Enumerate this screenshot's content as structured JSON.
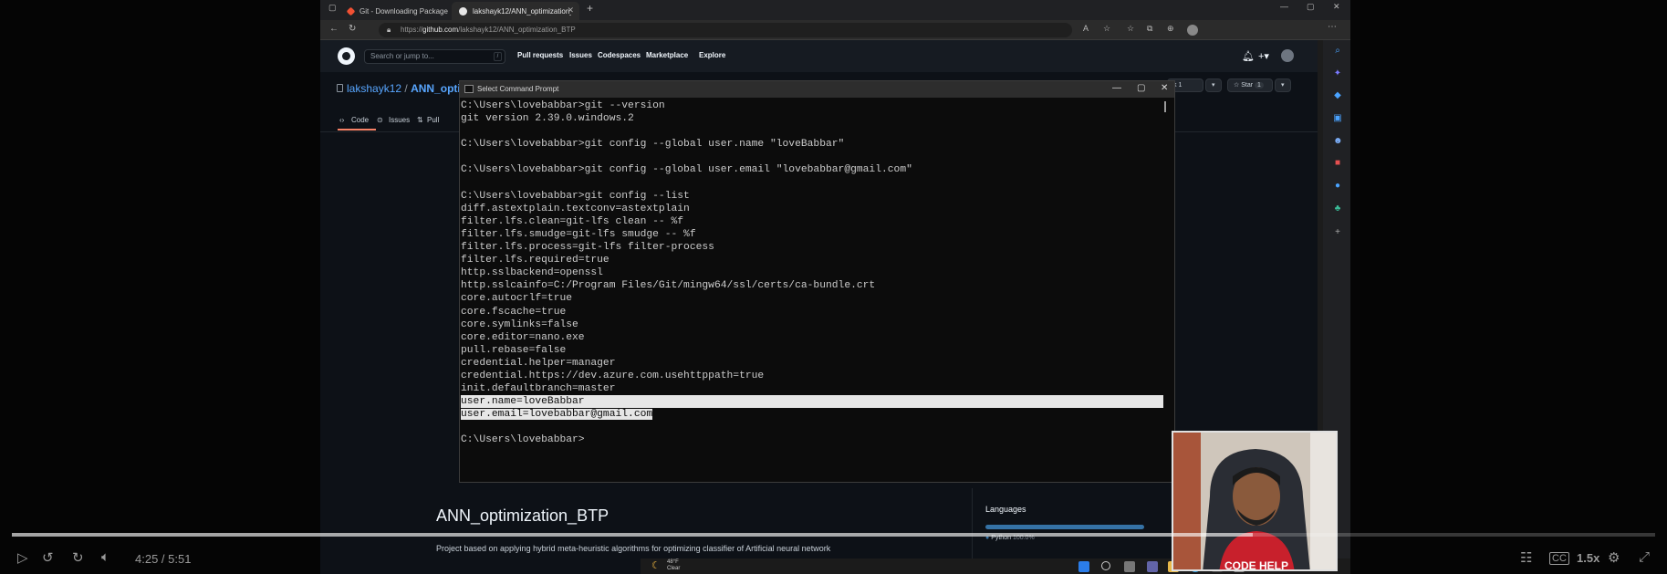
{
  "browser": {
    "tabs": [
      {
        "label": "Git - Downloading Package",
        "color": "#f05033"
      },
      {
        "label": "lakshayk12/ANN_optimization_B",
        "color": "#e6e6e6"
      }
    ],
    "url_prefix": "https://",
    "url_host": "github.com",
    "url_path": "/lakshayk12/ANN_optimization_BTP"
  },
  "github": {
    "search_placeholder": "Search or jump to...",
    "search_key": "/",
    "nav": [
      "Pull requests",
      "Issues",
      "Codespaces",
      "Marketplace",
      "Explore"
    ],
    "repo_owner": "lakshayk12",
    "repo_sep": " / ",
    "repo_name": "ANN_opti",
    "repo_tabs": [
      "Code",
      "Issues",
      "Pull"
    ],
    "fork_count": "k  1",
    "star_label": "Star",
    "star_count": "1",
    "readme_title": "ANN_optimization_BTP",
    "readme_desc": "Project based on applying hybrid meta-heuristic algorithms for optimizing classifier of Artificial neural network",
    "languages_title": "Languages",
    "language_name": "Python",
    "language_pct": "100.0%",
    "language_fraction": 1.0,
    "language_color": "#3572A5"
  },
  "cmd": {
    "title": "Select Command Prompt",
    "lines": [
      "C:\\Users\\lovebabbar>git --version",
      "git version 2.39.0.windows.2",
      "",
      "C:\\Users\\lovebabbar>git config --global user.name \"loveBabbar\"",
      "",
      "C:\\Users\\lovebabbar>git config --global user.email \"lovebabbar@gmail.com\"",
      "",
      "C:\\Users\\lovebabbar>git config --list",
      "diff.astextplain.textconv=astextplain",
      "filter.lfs.clean=git-lfs clean -- %f",
      "filter.lfs.smudge=git-lfs smudge -- %f",
      "filter.lfs.process=git-lfs filter-process",
      "filter.lfs.required=true",
      "http.sslbackend=openssl",
      "http.sslcainfo=C:/Program Files/Git/mingw64/ssl/certs/ca-bundle.crt",
      "core.autocrlf=true",
      "core.fscache=true",
      "core.symlinks=false",
      "core.editor=nano.exe",
      "pull.rebase=false",
      "credential.helper=manager",
      "credential.https://dev.azure.com.usehttppath=true",
      "init.defaultbranch=master",
      "user.name=loveBabbar",
      "user.email=lovebabbar@gmail.com",
      "",
      "C:\\Users\\lovebabbar>"
    ],
    "selected_full": 23,
    "selected_partial": 24
  },
  "taskbar": {
    "temp": "48°F",
    "condition": "Clear"
  },
  "player": {
    "time": "4:25 / 5:51",
    "progress_fraction": 0.755,
    "speed": "1.5x",
    "webcam_caption": "CODE HELP"
  }
}
